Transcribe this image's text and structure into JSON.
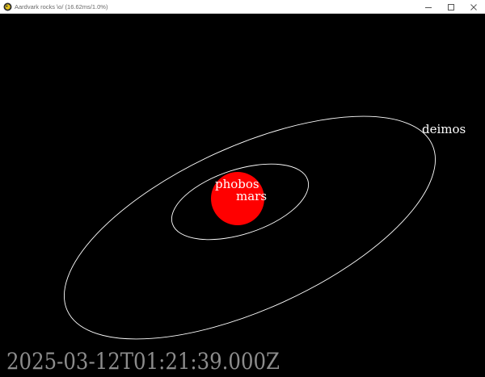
{
  "window": {
    "title": "Aardvark rocks \\o/ (16.62ms/1.0%)",
    "icon": "aardvark-icon",
    "controls": {
      "minimize_icon": "minimize-icon",
      "maximize_icon": "maximize-icon",
      "close_icon": "close-icon"
    }
  },
  "scene": {
    "background": "#000000",
    "orbit_color": "#ffffff",
    "planet": {
      "label": "mars",
      "color": "#ff0000"
    },
    "moons": [
      {
        "label": "phobos"
      },
      {
        "label": "deimos"
      }
    ],
    "timestamp": "2025-03-12T01:21:39.000Z"
  }
}
